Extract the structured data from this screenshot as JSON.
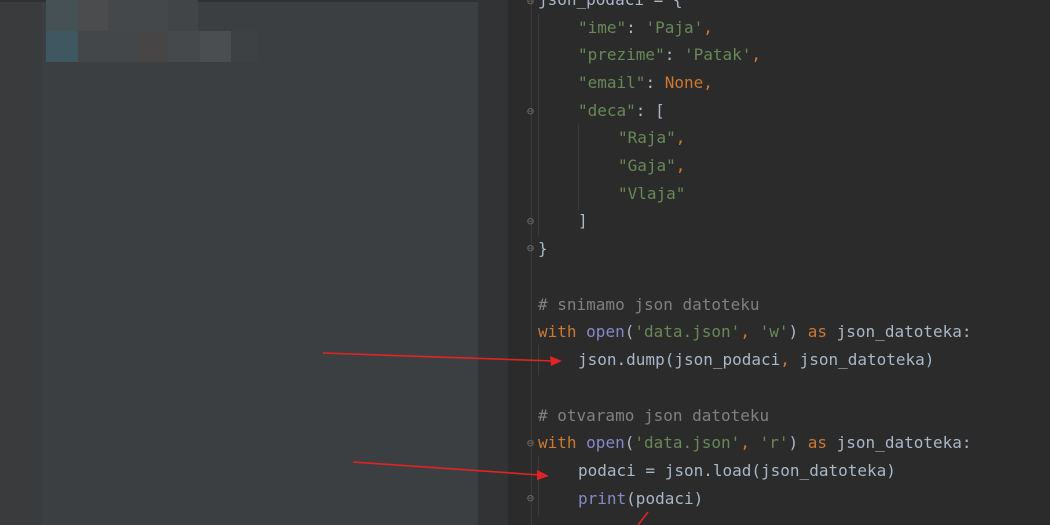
{
  "colors": {
    "background": "#2b2b2b",
    "string": "#6a8759",
    "keyword": "#cc7832",
    "comment": "#808080",
    "builtin": "#8888c6",
    "default": "#a9b7c6",
    "arrow": "#e02424"
  },
  "code": {
    "l1": {
      "var": "json_podaci",
      "op": " = {"
    },
    "l2": {
      "key": "\"ime\"",
      "colon": ": ",
      "val": "'Paja'",
      "comma": ","
    },
    "l3": {
      "key": "\"prezime\"",
      "colon": ": ",
      "val": "'Patak'",
      "comma": ","
    },
    "l4": {
      "key": "\"email\"",
      "colon": ": ",
      "val": "None",
      "comma": ","
    },
    "l5": {
      "key": "\"deca\"",
      "rest": ": ["
    },
    "l6": {
      "val": "\"Raja\"",
      "comma": ","
    },
    "l7": {
      "val": "\"Gaja\"",
      "comma": ","
    },
    "l8": {
      "val": "\"Vlaja\""
    },
    "l9": {
      "text": "]"
    },
    "l10": {
      "text": "}"
    },
    "l12": {
      "text": "# snimamo json datoteku"
    },
    "l13": {
      "kw_with": "with",
      "fn_open": "open",
      "p1": "(",
      "arg1": "'data.json'",
      "comma": ", ",
      "arg2": "'w'",
      "p2": ") ",
      "kw_as": "as",
      "tail": " json_datoteka:"
    },
    "l14": {
      "pre": "json.dump(json_podaci",
      "comma": ", ",
      "post": "json_datoteka)"
    },
    "l16": {
      "text": "# otvaramo json datoteku"
    },
    "l17": {
      "kw_with": "with",
      "fn_open": "open",
      "p1": "(",
      "arg1": "'data.json'",
      "comma": ", ",
      "arg2": "'r'",
      "p2": ") ",
      "kw_as": "as",
      "tail": " json_datoteka:"
    },
    "l18": {
      "text": "podaci = json.load(json_datoteka)"
    },
    "l19": {
      "fn_print": "print",
      "tail": "(podaci)"
    }
  }
}
